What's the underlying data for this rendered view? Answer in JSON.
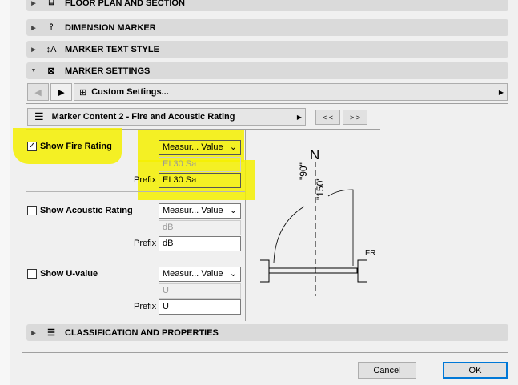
{
  "sections": {
    "floor_plan": "FLOOR PLAN AND SECTION",
    "dimension_marker": "DIMENSION MARKER",
    "marker_text_style": "MARKER TEXT STYLE",
    "marker_settings": "MARKER SETTINGS",
    "classification": "CLASSIFICATION AND PROPERTIES"
  },
  "nav": {
    "custom_settings": "Custom Settings..."
  },
  "content": {
    "title": "Marker Content 2 - Fire and Acoustic Rating",
    "prev": "< <",
    "next": "> >"
  },
  "rows": [
    {
      "label": "Show Fire Rating",
      "checked": true,
      "dropdown": "Measur... Value",
      "value": "EI 30 Sa",
      "prefix_label": "Prefix",
      "prefix": "EI 30 Sa"
    },
    {
      "label": "Show Acoustic Rating",
      "checked": false,
      "dropdown": "Measur... Value",
      "value": "dB",
      "prefix_label": "Prefix",
      "prefix": "dB"
    },
    {
      "label": "Show U-value",
      "checked": false,
      "dropdown": "Measur... Value",
      "value": "U",
      "prefix_label": "Prefix",
      "prefix": "U"
    }
  ],
  "preview": {
    "north": "N",
    "angle1": "\"90\"",
    "angle2": "\"150\"",
    "tag": "FR"
  },
  "footer": {
    "cancel": "Cancel",
    "ok": "OK"
  },
  "colors": {
    "highlight": "#f5f000",
    "ok_border": "#0078d7"
  }
}
